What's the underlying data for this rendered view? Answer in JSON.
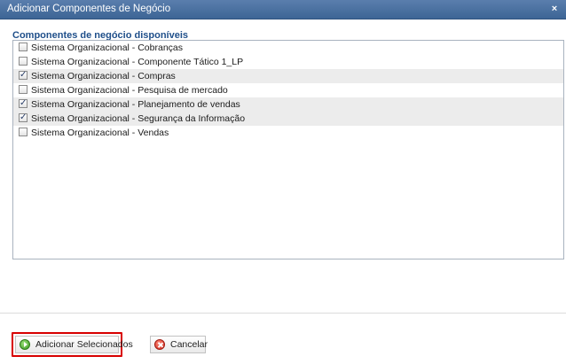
{
  "dialog": {
    "title": "Adicionar Componentes de Negócio",
    "close_symbol": "×"
  },
  "list": {
    "heading": "Componentes de negócio disponíveis",
    "items": [
      {
        "label": "Sistema Organizacional - Cobranças",
        "checked": false
      },
      {
        "label": "Sistema Organizacional - Componente Tático 1_LP",
        "checked": false
      },
      {
        "label": "Sistema Organizacional - Compras",
        "checked": true
      },
      {
        "label": "Sistema Organizacional - Pesquisa de mercado",
        "checked": false
      },
      {
        "label": "Sistema Organizacional - Planejamento de vendas",
        "checked": true
      },
      {
        "label": "Sistema Organizacional - Segurança da Informação",
        "checked": true
      },
      {
        "label": "Sistema Organizacional - Vendas",
        "checked": false
      }
    ]
  },
  "footer": {
    "add_selected_label": "Adicionar Selecionados",
    "cancel_label": "Cancelar"
  },
  "icons": {
    "add": "add-circle-icon",
    "cancel": "cancel-circle-icon",
    "checkmark": "checkmark-icon"
  },
  "colors": {
    "titlebar": "#4a719f",
    "heading": "#1f4f8a",
    "highlight": "#d80000"
  }
}
